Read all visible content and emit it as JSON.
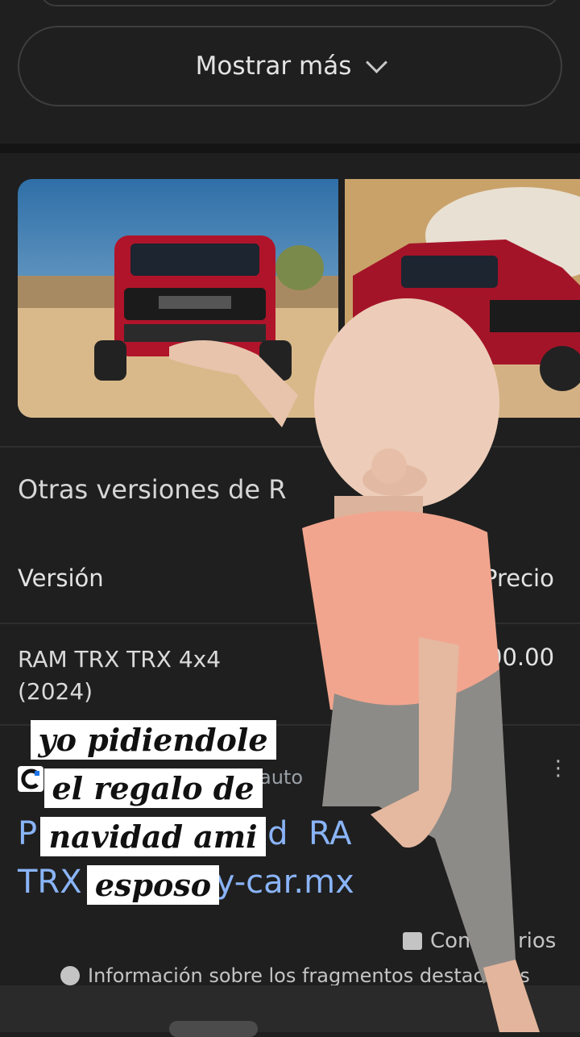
{
  "show_more": {
    "label": "Mostrar más"
  },
  "section_title": "Otras versiones de R",
  "table": {
    "col_version": "Versión",
    "col_price": "Precio",
    "rows": [
      {
        "version": "RAM TRX TRX 4x4",
        "year": "(2024)",
        "price": "00.00"
      }
    ]
  },
  "result": {
    "source_name": "auto",
    "title_line1": "P              ones d  RA",
    "title_line2": "TRX          my-car.mx"
  },
  "footer": {
    "comments": "Com      rios",
    "info": "Información sobre los fragmentos destacados"
  },
  "caption": {
    "lines": [
      "yo pidiendole",
      "el regalo de",
      "navidad ami",
      "esposo"
    ]
  },
  "colors": {
    "background": "#1f1f1f",
    "link": "#8ab4f8",
    "truck_red": "#b0142a",
    "shirt": "#f2a58e"
  }
}
